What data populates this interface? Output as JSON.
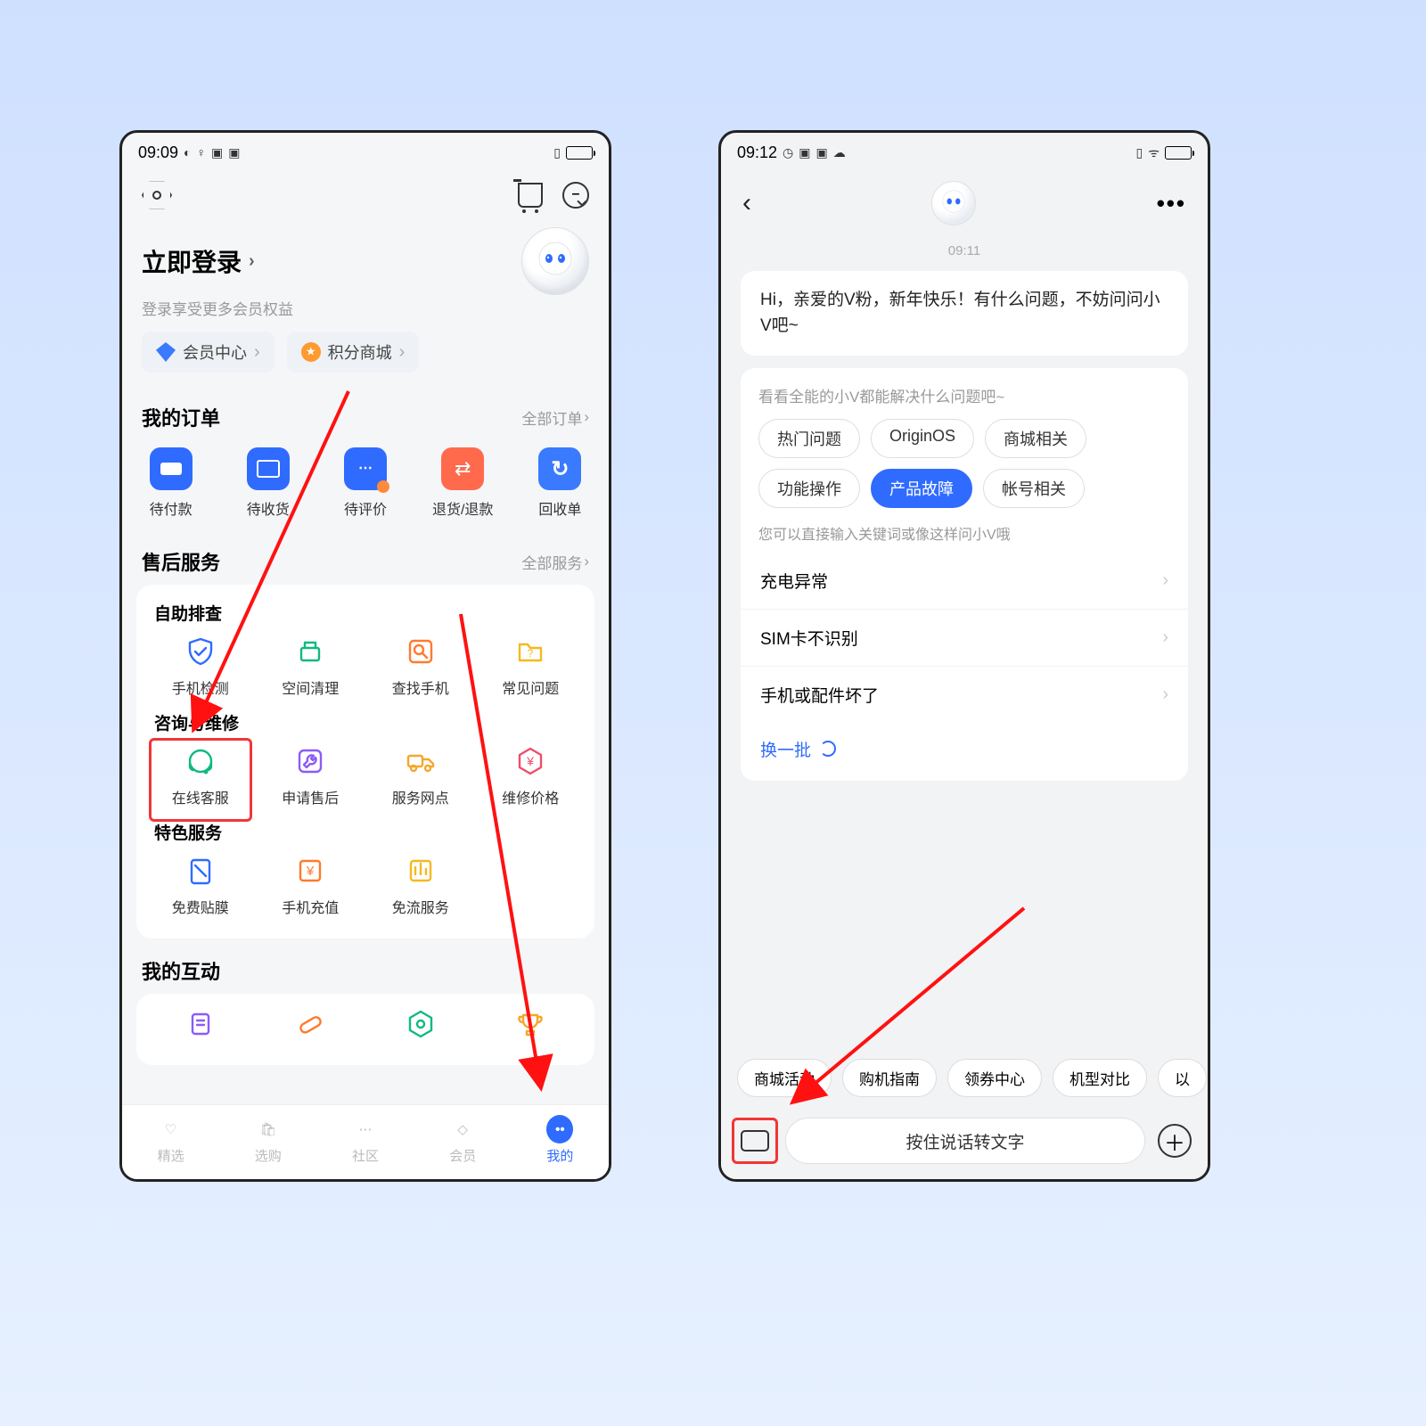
{
  "left": {
    "status": {
      "time": "09:09",
      "battFill": "#111",
      "battWidth": 26
    },
    "login": {
      "title": "立即登录",
      "sub": "登录享受更多会员权益"
    },
    "pills": [
      {
        "icon": "diamond",
        "label": "会员中心"
      },
      {
        "icon": "star",
        "label": "积分商城"
      }
    ],
    "orders": {
      "title": "我的订单",
      "more": "全部订单",
      "items": [
        {
          "label": "待付款"
        },
        {
          "label": "待收货"
        },
        {
          "label": "待评价"
        },
        {
          "label": "退货/退款"
        },
        {
          "label": "回收单"
        }
      ]
    },
    "service": {
      "title": "售后服务",
      "more": "全部服务",
      "groups": [
        {
          "title": "自助排查",
          "items": [
            {
              "label": "手机检测",
              "c": "#2f6bff",
              "svg": "shield"
            },
            {
              "label": "空间清理",
              "c": "#10b981",
              "svg": "broom"
            },
            {
              "label": "查找手机",
              "c": "#ff7a2d",
              "svg": "search"
            },
            {
              "label": "常见问题",
              "c": "#f5b91f",
              "svg": "folderq"
            }
          ]
        },
        {
          "title": "咨询与维修",
          "hl": 0,
          "items": [
            {
              "label": "在线客服",
              "c": "#10b981",
              "svg": "headset"
            },
            {
              "label": "申请售后",
              "c": "#8b5cf6",
              "svg": "wrench"
            },
            {
              "label": "服务网点",
              "c": "#f5a62d",
              "svg": "truck"
            },
            {
              "label": "维修价格",
              "c": "#ef4d6a",
              "svg": "pricehex"
            }
          ]
        },
        {
          "title": "特色服务",
          "items": [
            {
              "label": "免费贴膜",
              "c": "#2f6bff",
              "svg": "film"
            },
            {
              "label": "手机充值",
              "c": "#ff7a2d",
              "svg": "yen"
            },
            {
              "label": "免流服务",
              "c": "#f5b91f",
              "svg": "data"
            }
          ]
        }
      ]
    },
    "interact": {
      "title": "我的互动",
      "items": [
        {
          "c": "#8b5cf6",
          "svg": "doc"
        },
        {
          "c": "#ff7a2d",
          "svg": "pill"
        },
        {
          "c": "#10b981",
          "svg": "gearhex"
        },
        {
          "c": "#f5a62d",
          "svg": "trophy"
        }
      ]
    },
    "nav": [
      {
        "label": "精选"
      },
      {
        "label": "选购"
      },
      {
        "label": "社区"
      },
      {
        "label": "会员"
      },
      {
        "label": "我的",
        "active": true
      }
    ]
  },
  "right": {
    "status": {
      "time": "09:12",
      "battFill": "#f8c92d",
      "battWidth": 26
    },
    "timestamp": "09:11",
    "greeting": "Hi，亲爱的V粉，新年快乐！有什么问题，不妨问问小V吧~",
    "panel": {
      "lead": "看看全能的小V都能解决什么问题吧~",
      "chips": [
        "热门问题",
        "OriginOS",
        "商城相关",
        "功能操作",
        "产品故障",
        "帐号相关"
      ],
      "selected": 4,
      "hint": "您可以直接输入关键词或像这样问小V哦",
      "qs": [
        "充电异常",
        "SIM卡不识别",
        "手机或配件坏了"
      ],
      "refresh": "换一批"
    },
    "suggest": [
      "商城活动",
      "购机指南",
      "领券中心",
      "机型对比",
      "以"
    ],
    "voice": "按住说话转文字"
  }
}
